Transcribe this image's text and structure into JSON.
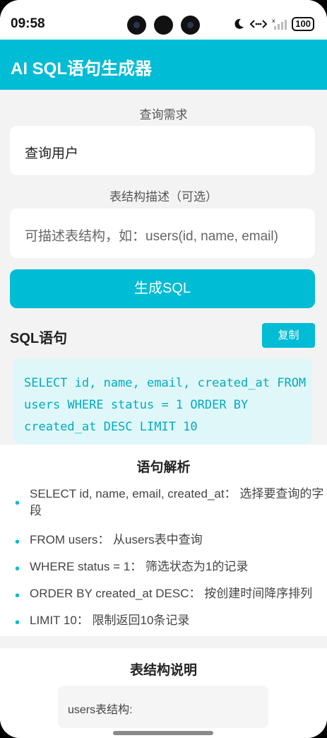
{
  "status_bar": {
    "time": "09:58",
    "battery": "100"
  },
  "header": {
    "title": "AI SQL语句生成器"
  },
  "query": {
    "label": "查询需求",
    "value": "查询用户"
  },
  "schema": {
    "label": "表结构描述（可选）",
    "placeholder": "可描述表结构，如：users(id, name, email)"
  },
  "generate_button": "生成SQL",
  "sql_section": {
    "title": "SQL语句",
    "copy_label": "复制",
    "code": "SELECT id, name, email, created_at FROM users WHERE status = 1 ORDER BY created_at DESC LIMIT 10"
  },
  "explanation": {
    "title": "语句解析",
    "items": [
      "SELECT id, name, email, created_at： 选择要查询的字段",
      "FROM users： 从users表中查询",
      "WHERE status = 1： 筛选状态为1的记录",
      "ORDER BY created_at DESC： 按创建时间降序排列",
      "LIMIT 10： 限制返回10条记录"
    ]
  },
  "table_section": {
    "title": "表结构说明",
    "content": "users表结构:"
  },
  "colors": {
    "accent": "#00bcd4",
    "code_bg": "#e0f7fa",
    "code_text": "#00acc1"
  }
}
